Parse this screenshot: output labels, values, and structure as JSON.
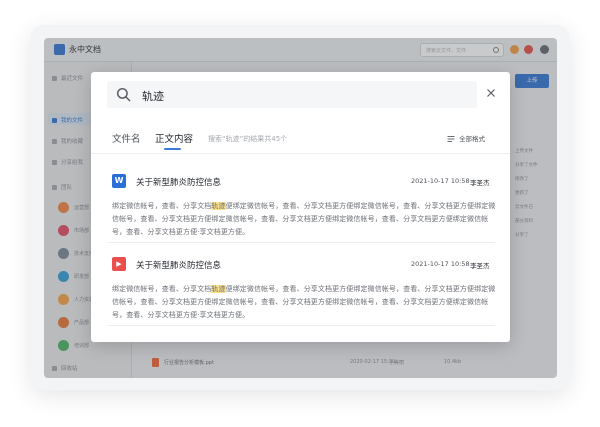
{
  "app": {
    "title": "永中文档",
    "search_placeholder": "搜索云文件、文件",
    "upload_label": "上传",
    "accent": "#3a7bd5"
  },
  "sidebar": {
    "items": [
      {
        "label": "最近文件",
        "icon": "clock-icon"
      },
      {
        "label": "我的文件",
        "icon": "folder-icon",
        "active": true
      },
      {
        "label": "我的收藏",
        "icon": "star-icon"
      },
      {
        "label": "分享给我",
        "icon": "share-icon"
      }
    ],
    "team_label": "团队",
    "teams": [
      {
        "label": "运营部",
        "color": "#f2874a"
      },
      {
        "label": "市场部",
        "color": "#e2536a"
      },
      {
        "label": "技术支持部",
        "color": "#7f8c99"
      },
      {
        "label": "研发部",
        "color": "#3aa1d9"
      },
      {
        "label": "人力资源部",
        "color": "#f3a64c"
      },
      {
        "label": "产品部",
        "color": "#e77b3c"
      },
      {
        "label": "培训部",
        "color": "#4fb46a"
      }
    ],
    "recycle_label": "回收站"
  },
  "right_panel": {
    "lines": [
      "上传文件",
      "分享了文件",
      "修改了",
      "更新了",
      "云文件已",
      "部分资料",
      "分享了"
    ]
  },
  "background_row": {
    "name": "行业报告分析模板.ppt",
    "date": "2020-02-17 15:30",
    "owner": "小美丽",
    "size": "10.4kb"
  },
  "modal": {
    "query": "轨迹",
    "tabs": [
      {
        "label": "文件名",
        "active": false
      },
      {
        "label": "正文内容",
        "active": true
      }
    ],
    "result_count": "搜索“轨迹”的结果共45个",
    "filter_label": "全部格式",
    "results": [
      {
        "type": "word",
        "icon_glyph": "W",
        "icon_color": "#2b6fd6",
        "title": "关于新型肺炎防控信息",
        "date": "2021-10-17  10:58",
        "author": "李圣杰",
        "snippet_before": "绑定微信帐号，查看、分享文档",
        "snippet_match": "轨迹",
        "snippet_after": "便绑定微信帐号，查看、分享文档更方便绑定微信帐号，查看、分享文档更方便绑定微信帐号，查看、分享文档更方便绑定微信帐号，查看、分享文档更方便绑定微信帐号，查看、分享文档更方便绑定微信帐号，查看、分享文档更方便·享文档更方便。"
      },
      {
        "type": "pdf",
        "icon_glyph": "▶",
        "icon_color": "#ea4e4e",
        "title": "关于新型肺炎防控信息",
        "date": "2021-10-17  10:58",
        "author": "李圣杰",
        "snippet_before": "绑定微信帐号，查看、分享文档",
        "snippet_match": "轨迹",
        "snippet_after": "便绑定微信帐号，查看、分享文档更方便绑定微信帐号，查看、分享文档更方便绑定微信帐号，查看、分享文档更方便绑定微信帐号，查看、分享文档更方便绑定微信帐号，查看、分享文档更方便绑定微信帐号，查看、分享文档更方便·享文档更方便。"
      }
    ]
  }
}
